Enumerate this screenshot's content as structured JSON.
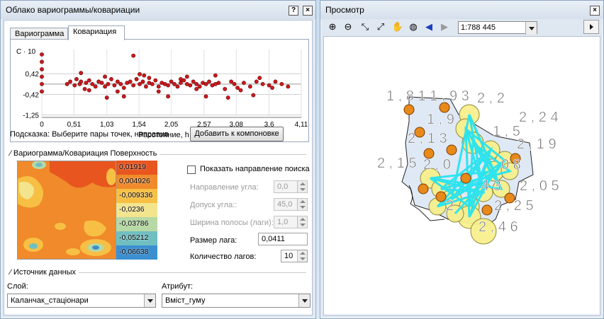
{
  "left_window": {
    "title": "Облако вариограммы/ковариации",
    "help_btn": "?",
    "close_btn": "×",
    "tabs": [
      {
        "label": "Вариограмма",
        "active": false
      },
      {
        "label": "Ковариация",
        "active": true
      }
    ],
    "chart": {
      "y_axis_title": "C · 10",
      "y_ticks": [
        "0,42",
        "-0,42",
        "-1,25"
      ],
      "x_ticks": [
        "0",
        "0,51",
        "1,03",
        "1,54",
        "2,05",
        "2,57",
        "3,08",
        "3,6",
        "4,11"
      ],
      "xlabel": "Расстояние, h · 10"
    },
    "hint": "Подсказка:  Выберите пары точек, направив",
    "add_button": "Добавить к компоновке",
    "surface_group_title": "Вариограмма/Ковариация Поверхность",
    "legend": [
      {
        "label": "0,01919",
        "color": "#e8551f"
      },
      {
        "label": "0,004926",
        "color": "#f08a2a"
      },
      {
        "label": "-0,009336",
        "color": "#f7c045"
      },
      {
        "label": "-0,0236",
        "color": "#f3e48e"
      },
      {
        "label": "-0,03786",
        "color": "#b6d9a5"
      },
      {
        "label": "-0,05212",
        "color": "#6fbfc1"
      },
      {
        "label": "-0,06638",
        "color": "#3b8fd0"
      }
    ],
    "search_direction_label": "Показать направление поиска",
    "angle_direction": {
      "label": "Направление угла:",
      "value": "0,0"
    },
    "angle_tolerance": {
      "label": "Допуск угла::",
      "value": "45,0"
    },
    "bandwidth": {
      "label": "Ширина полосы (лаги):",
      "value": "1,0"
    },
    "lag_size": {
      "label": "Размер лага:",
      "value": "0,0411"
    },
    "lag_count": {
      "label": "Количество лагов:",
      "value": "10"
    },
    "source_group_title": "Источник данных",
    "layer": {
      "label": "Слой:",
      "value": "Каланчак_стаціонари"
    },
    "attribute": {
      "label": "Атрибут:",
      "value": "Вміст_гуму"
    }
  },
  "right_window": {
    "title": "Просмотр",
    "close_btn": "×",
    "scale": "1:788 445",
    "map_labels": [
      "1 , 8 1 1 , 9 3",
      "2 , 2",
      "2 , 2 4",
      "1 , 9",
      "1 , 5",
      "2 , 1 3",
      "2 , 1 9",
      "2 , 1 5",
      "2 , 0",
      "0 8",
      "4 3",
      "2 , 0 5",
      "2",
      "2 , 2 5",
      "2 , 4 6"
    ]
  },
  "chart_data": {
    "type": "scatter",
    "title": "",
    "xlabel": "Расстояние, h · 10",
    "ylabel": "C · 10",
    "x_ticks": [
      0,
      0.51,
      1.03,
      1.54,
      2.05,
      2.57,
      3.08,
      3.6,
      4.11
    ],
    "y_ticks": [
      0.42,
      -0.42,
      -1.25
    ],
    "xlim": [
      0,
      4.11
    ],
    "ylim": [
      -1.35,
      1.4
    ],
    "series": [
      {
        "x": [
          0,
          0,
          0,
          0,
          0,
          0,
          0.4,
          0.45,
          0.52,
          0.55,
          0.6,
          0.62,
          0.68,
          0.7,
          0.75,
          0.8,
          0.85,
          0.9,
          0.95,
          1.0,
          1.05,
          1.1,
          1.15,
          1.2,
          1.25,
          1.3,
          1.35,
          1.4,
          1.45,
          1.5,
          1.55,
          1.6,
          1.65,
          1.7,
          1.75,
          1.8,
          1.85,
          1.9,
          1.95,
          2.0,
          2.05,
          2.1,
          2.15,
          2.2,
          2.25,
          2.3,
          2.35,
          2.4,
          2.45,
          2.5,
          2.55,
          2.6,
          2.65,
          2.7,
          2.75,
          2.8,
          2.9,
          3.0,
          3.05,
          3.1,
          3.2,
          3.3,
          3.4,
          3.5,
          3.6,
          3.7,
          3.8,
          3.9,
          1.45,
          1.55,
          0.62,
          1.03,
          1.3,
          1.62,
          2.0,
          2.3,
          2.6,
          2.95,
          3.35,
          0.75,
          1.2,
          1.85,
          2.45,
          3.15,
          3.65,
          1.0,
          1.7,
          2.2,
          2.75,
          3.45
        ],
        "y": [
          1.2,
          0.9,
          0.6,
          0.3,
          0.0,
          -0.3,
          0.0,
          0.1,
          -0.05,
          0.2,
          0.0,
          0.1,
          -0.2,
          0.05,
          0.15,
          0.0,
          -0.1,
          0.1,
          0.05,
          -0.1,
          0.0,
          0.2,
          -0.05,
          0.1,
          0.0,
          -0.15,
          0.05,
          0.1,
          -0.05,
          0.2,
          0.0,
          0.1,
          -0.1,
          0.05,
          0.0,
          0.15,
          -0.1,
          0.05,
          0.0,
          -0.05,
          0.1,
          0.0,
          -0.1,
          0.05,
          0.15,
          0.0,
          -0.05,
          0.1,
          0.0,
          -0.1,
          0.05,
          0.0,
          0.1,
          -0.05,
          0.0,
          0.05,
          -0.2,
          0.1,
          0.0,
          -0.15,
          0.05,
          -0.1,
          0.1,
          0.0,
          -0.05,
          0.1,
          0.0,
          -0.1,
          1.15,
          0.4,
          0.45,
          -0.55,
          -0.5,
          0.35,
          -0.5,
          0.3,
          -0.5,
          -0.55,
          -0.45,
          -0.25,
          -0.3,
          -0.3,
          -0.2,
          -0.25,
          -0.15,
          0.3,
          0.25,
          0.2,
          0.35,
          0.25
        ]
      }
    ]
  }
}
